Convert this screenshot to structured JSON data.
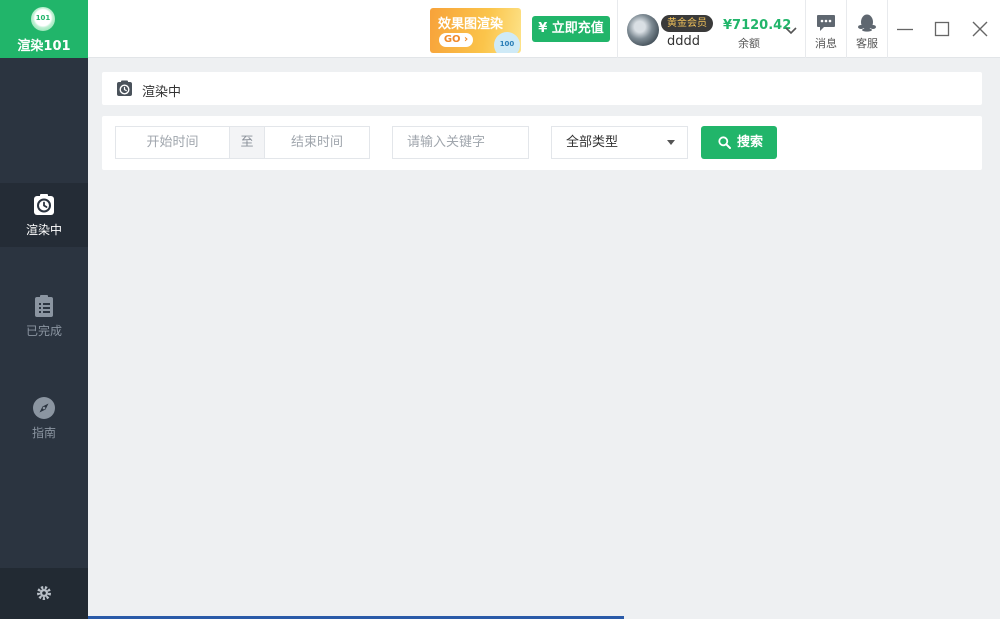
{
  "app": {
    "logo_badge": "101",
    "logo_text": "渲染101"
  },
  "sidebar": {
    "items": [
      {
        "label": "渲染中",
        "icon": "clock-icon",
        "active": true
      },
      {
        "label": "已完成",
        "icon": "clipboard-list-icon",
        "active": false
      },
      {
        "label": "指南",
        "icon": "compass-icon",
        "active": false
      }
    ],
    "settings_icon": "gear-icon"
  },
  "header": {
    "promo_title": "效果图渲染",
    "promo_go": "GO",
    "promo_badge": "100",
    "recharge_label": "¥ 立即充值",
    "member_badge": "黄金会员",
    "username": "dddd",
    "balance": "¥7120.42",
    "balance_label": "余额",
    "message_label": "消息",
    "service_label": "客服"
  },
  "page": {
    "title": "渲染中"
  },
  "filters": {
    "start_placeholder": "开始时间",
    "to_label": "至",
    "end_placeholder": "结束时间",
    "keyword_placeholder": "请输入关键字",
    "type_selected": "全部类型",
    "search_label": "搜索"
  },
  "colors": {
    "accent": "#21b56a",
    "sidebar_bg": "#2b3440",
    "balance": "#21b56a"
  }
}
